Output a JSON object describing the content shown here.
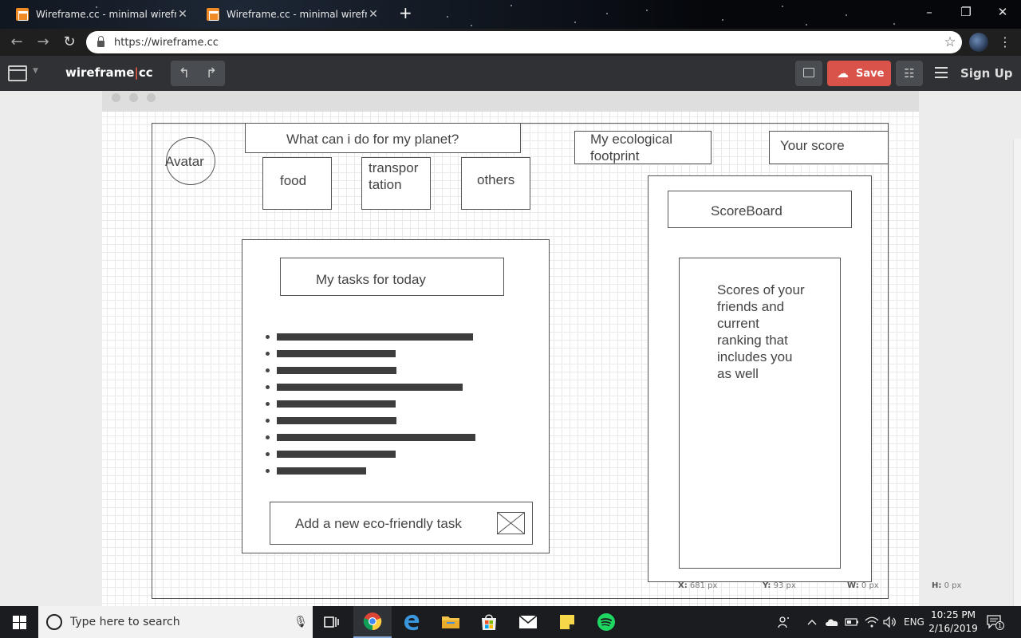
{
  "browser": {
    "tabs": [
      {
        "title": "Wireframe.cc - minimal wirefram"
      },
      {
        "title": "Wireframe.cc - minimal wirefram"
      }
    ],
    "url": "https://wireframe.cc"
  },
  "app": {
    "brand_left": "wireframe",
    "brand_sep": "|",
    "brand_right": "cc",
    "save_label": "Save",
    "signup_label": "Sign Up",
    "accent_color": "#d9534a"
  },
  "wireframe": {
    "avatar": "Avatar",
    "headline": "What can i do for my planet?",
    "categories": [
      "food",
      "transpor tation",
      "others"
    ],
    "footprint": "My ecological footprint",
    "your_score": "Your score",
    "tasks_title": "My tasks for today",
    "task_bullet_count": 9,
    "add_task": "Add a new eco-friendly task",
    "scoreboard_title": "ScoreBoard",
    "scoreboard_text": "Scores of your friends and current ranking that includes you as well"
  },
  "readout": {
    "x_label": "X:",
    "x_value": "681 px",
    "y_label": "Y:",
    "y_value": "93 px",
    "w_label": "W:",
    "w_value": "0 px",
    "h_label": "H:",
    "h_value": "0 px"
  },
  "taskbar": {
    "search_placeholder": "Type here to search",
    "language": "ENG",
    "time": "10:25 PM",
    "date": "2/16/2019",
    "notification_count": "1"
  }
}
